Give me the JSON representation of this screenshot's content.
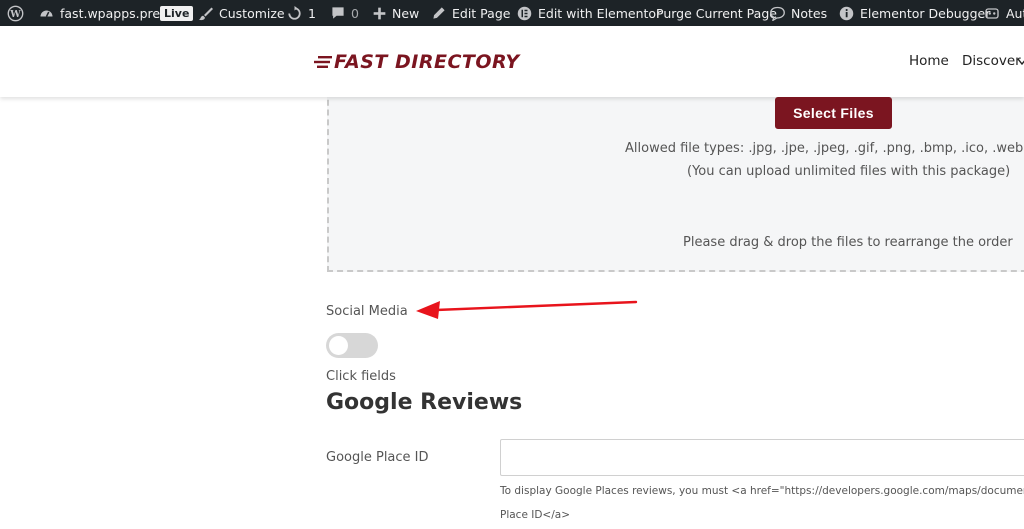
{
  "adminbar": {
    "site_name": "fast.wpapps.press",
    "live_badge": "Live",
    "customize": "Customize",
    "updates_count": "1",
    "comments_count": "0",
    "new": "New",
    "edit_page": "Edit Page",
    "edit_elementor": "Edit with Elementor",
    "purge": "Purge Current Page",
    "notes": "Notes",
    "debugger": "Elementor Debugger",
    "auto": "Aut"
  },
  "header": {
    "logo_text": "FAST DIRECTORY",
    "nav": [
      "Home",
      "Discover"
    ]
  },
  "upload": {
    "button_label": "Select Files",
    "allowed_types": "Allowed file types: .jpg, .jpe, .jpeg, .gif, .png, .bmp, .ico, .webp, .a",
    "unlimited_note": "(You can upload unlimited files with this package)",
    "drag_note": "Please drag & drop the files to rearrange the order"
  },
  "social": {
    "label": "Social Media",
    "toggle_on": false,
    "hint": "Click fields"
  },
  "reviews": {
    "heading": "Google Reviews",
    "place_id_label": "Google Place ID",
    "place_id_value": "",
    "help_line1": "To display Google Places reviews, you must <a href=\"https://developers.google.com/maps/documentat",
    "help_line2": "Place ID</a>"
  },
  "colors": {
    "brand": "#7b1520",
    "adminbar": "#1d2327",
    "annotation_arrow": "#e8141c"
  }
}
